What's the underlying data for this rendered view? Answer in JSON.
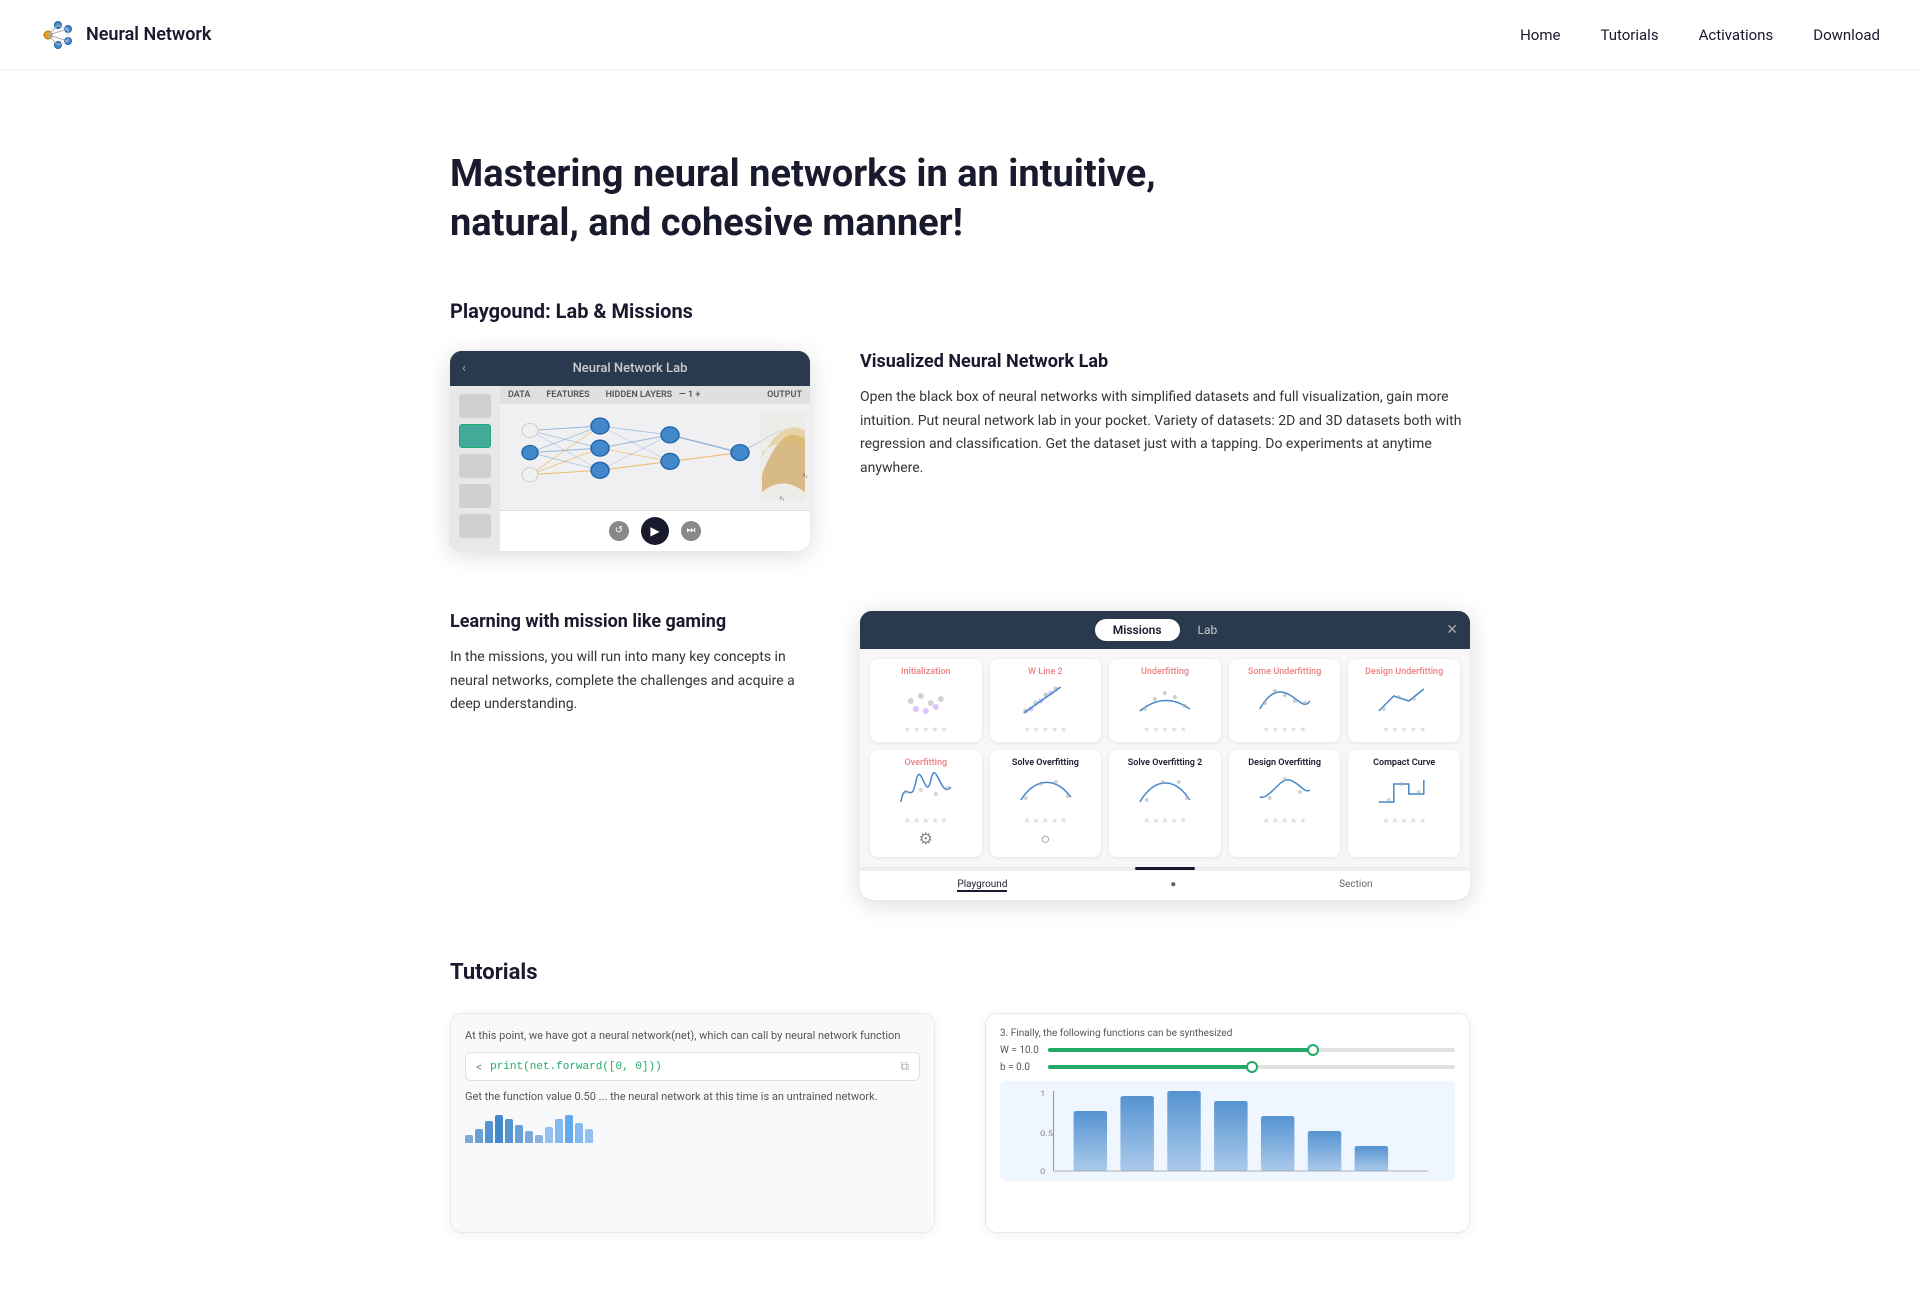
{
  "nav": {
    "logo_text": "Neural Network",
    "links": [
      {
        "label": "Home",
        "name": "home"
      },
      {
        "label": "Tutorials",
        "name": "tutorials"
      },
      {
        "label": "Activations",
        "name": "activations"
      },
      {
        "label": "Download",
        "name": "download"
      }
    ]
  },
  "hero": {
    "title": "Mastering neural networks in an intuitive, natural, and cohesive manner!"
  },
  "playground": {
    "section_title": "Playgound: Lab & Missions",
    "lab": {
      "title": "Visualized Neural Network Lab",
      "window_title": "Neural Network Lab",
      "description": "Open the black box of neural networks with simplified datasets and full visualization, gain more intuition.\nPut neural network lab in your pocket. Variety of datasets: 2D and 3D datasets both with regression and classification. Get the dataset just with a tapping. Do experiments at anytime anywhere.",
      "header_labels": [
        "DATA",
        "FEATURES",
        "HIDDEN LAYERS",
        "— 1 +",
        "OUTPUT"
      ]
    },
    "missions": {
      "learning_title": "Learning with mission like gaming",
      "learning_text": "In the missions, you will run into many key concepts in neural networks, complete the challenges and acquire a deep understanding.",
      "tab_missions": "Missions",
      "tab_lab": "Lab",
      "cards": [
        {
          "title": "Initialization",
          "color": "red"
        },
        {
          "title": "W Line 2",
          "color": "red"
        },
        {
          "title": "Underfitting",
          "color": "red"
        },
        {
          "title": "Some Underfitting",
          "color": "red"
        },
        {
          "title": "Design Underfitting",
          "color": "red"
        },
        {
          "title": "Overfitting",
          "color": "red"
        },
        {
          "title": "Solve Overfitting",
          "color": "dark"
        },
        {
          "title": "Solve Overfitting 2",
          "color": "dark"
        },
        {
          "title": "Design Overfitting",
          "color": "dark"
        },
        {
          "title": "Compact Curve",
          "color": "dark"
        }
      ],
      "bottom_bar": [
        "Playground",
        "●",
        "Section"
      ]
    }
  },
  "tutorials": {
    "section_title": "Tutorials",
    "code_label": "At this point, we have got a neural network(net), which can call by neural network function",
    "code_text": "print(net.forward([0, 0]))",
    "code_desc": "Get the function value 0.50 ... the neural network at this time is an untrained network.",
    "chart_label": "3. Finally, the following functions can be synthesized"
  }
}
